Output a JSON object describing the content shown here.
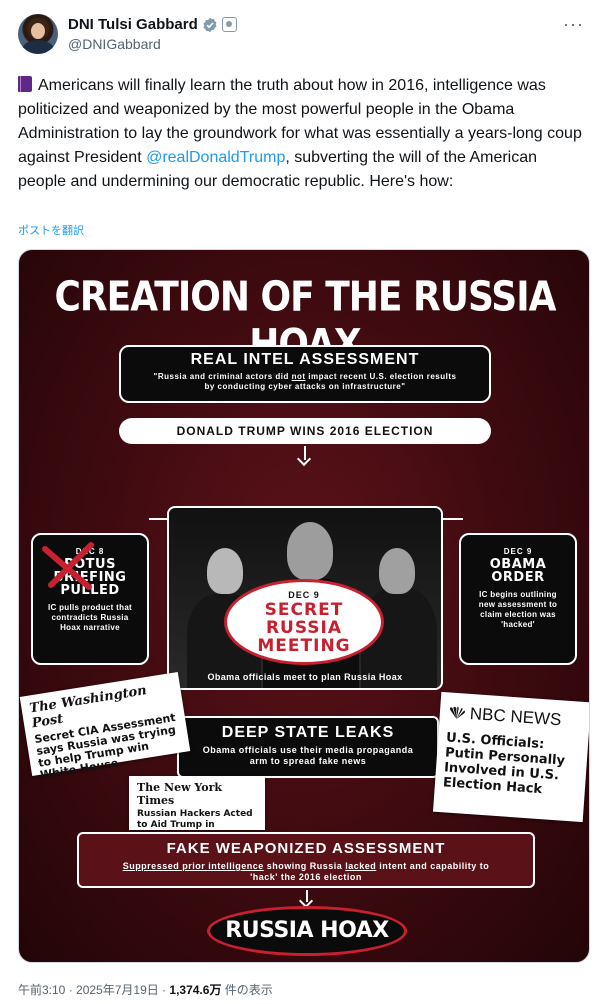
{
  "author": {
    "display_name": "DNI Tulsi Gabbard",
    "handle": "@DNIGabbard"
  },
  "tweet": {
    "text_part1": "Americans will finally learn the truth about how in 2016, intelligence was politicized and weaponized by the most powerful people in the Obama Administration to lay the groundwork for what was essentially a years-long coup against President ",
    "mention": "@realDonaldTrump",
    "text_part2": ", subverting the will of the American people and undermining our democratic republic. Here's how:",
    "translate_label": "ポストを翻訳"
  },
  "infographic": {
    "title": "CREATION OF THE RUSSIA HOAX",
    "real_intel": {
      "title": "REAL INTEL ASSESSMENT",
      "quote_a": "\"Russia and criminal actors did ",
      "quote_not": "not",
      "quote_b": " impact recent U.S. election results by conducting cyber attacks on infrastructure\""
    },
    "trump_wins": "DONALD TRUMP WINS 2016 ELECTION",
    "potus_briefing": {
      "date": "DEC 8",
      "title": "POTUS BRIEFING PULLED",
      "desc": "IC pulls product that contradicts Russia Hoax narrative"
    },
    "obama_order": {
      "date": "DEC 9",
      "title": "OBAMA ORDER",
      "desc": "IC begins outlining new assessment to claim election was 'hacked'"
    },
    "secret_meeting": {
      "date": "DEC 9",
      "title": "SECRET RUSSIA MEETING",
      "caption": "Obama officials meet to plan Russia Hoax"
    },
    "deep_state": {
      "title": "DEEP STATE LEAKS",
      "desc": "Obama officials use their media propaganda arm to spread fake news"
    },
    "wapo": {
      "masthead": "The Washington Post",
      "headline": "Secret CIA Assessment says Russia was trying to help Trump win White House"
    },
    "nbc": {
      "masthead": "NBC NEWS",
      "headline": "U.S. Officials: Putin Personally Involved in U.S. Election Hack"
    },
    "nyt": {
      "masthead": "The New York Times",
      "headline": "Russian Hackers Acted to Aid Trump in Election, U.S. Says"
    },
    "fake_assessment": {
      "title": "FAKE WEAPONIZED ASSESSMENT",
      "desc_u1": "Suppressed prior intelligence",
      "desc_a": " showing Russia ",
      "desc_u2": "lacked",
      "desc_b": " intent and capability to 'hack' the 2016 election"
    },
    "final": "RUSSIA HOAX"
  },
  "footer": {
    "time": "午前3:10 · 2025年7月19日 · ",
    "views": "1,374.6万",
    "views_label": " 件の表示"
  },
  "colors": {
    "accent_red": "#c8202f",
    "link_blue": "#1d9bf0",
    "background_maroon": "#3c0a0f"
  }
}
